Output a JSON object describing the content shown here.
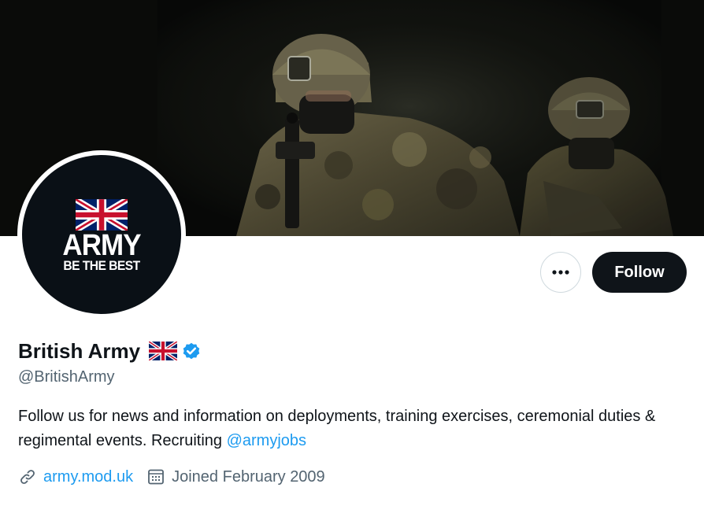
{
  "profile": {
    "display_name": "British Army",
    "name_flag_emoji": "uk-flag",
    "verified": true,
    "handle": "@BritishArmy",
    "avatar": {
      "flag": "uk-flag",
      "wordmark": "ARMY",
      "tagline": "BE THE BEST"
    },
    "bio": {
      "text": "Follow us for news and information on deployments, training exercises, ceremonial duties & regimental events. Recruiting ",
      "mention": "@armyjobs"
    },
    "website": "army.mod.uk",
    "joined": "Joined February 2009"
  },
  "actions": {
    "more_label": "•••",
    "follow_label": "Follow"
  },
  "icons": {
    "link": "link-icon",
    "calendar": "calendar-icon",
    "verified": "verified-badge-icon",
    "more": "more-options-icon"
  },
  "colors": {
    "link_blue": "#1d9bf0",
    "text_primary": "#0f1419",
    "text_secondary": "#536471",
    "follow_bg": "#0f1419",
    "avatar_bg": "#0a1016",
    "flag_red": "#c8102e",
    "flag_blue": "#012169"
  }
}
